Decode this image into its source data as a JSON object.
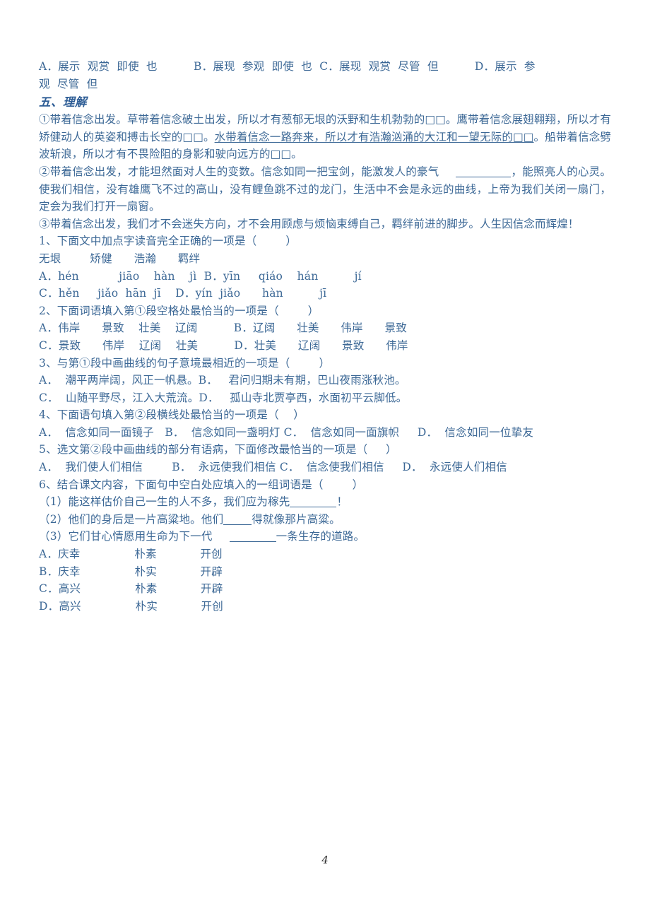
{
  "document": {
    "page_number": "4",
    "text_color": "#3c6896",
    "page_number_color": "#2b2b2b",
    "background_color": "#ffffff"
  },
  "top_options": {
    "line1": "A．展示  观赏  即使  也          B．展现  参观  即使  也  C．展现  观赏  尽管  但          D．展示  参",
    "line2": "观  尽管  但"
  },
  "section": {
    "heading": "五、理解"
  },
  "passage": {
    "para1_pre": "①带着信念出发。草带着信念破土出发，所以才有葱郁无垠的沃野和生机勃勃的□□。鹰带着信念展翅翱翔，所以才有矫健动人的英姿和搏击长空的□□。",
    "para1_underlined": "水带着信念一路奔来，所以才有浩瀚汹涌的大江和一望无际的□□",
    "para1_post": "。船带着信念劈波斩浪，所以才有不畏险阻的身影和驶向远方的□□。",
    "para2_pre": "②带着信念出发，才能坦然面对人生的变数。信念如同一把宝剑，能激发人的豪气",
    "para2_mid": "，能照亮人的心灵。",
    "para2_rest": "使我们相信，没有雄鹰飞不过的高山，没有鲤鱼跳不过的龙门，生活中不会是永远的曲线，上帝为我们关闭一扇门，定会为我们打开一扇窗。",
    "para3": "③带着信念出发，我们才不会迷失方向，才不会用顾虑与烦恼束缚自己，羁绊前进的脚步。人生因信念而辉煌！"
  },
  "questions": [
    {
      "stem": "1、下面文中加点字读音完全正确的一项是（        ）",
      "words_line": "无垠        矫健      浩瀚      羁绊",
      "options": [
        "A．hén           jiāo    hàn    jì  B．yīn     qiáo    hán          jí",
        "C．hěn     jiǎo  hān  jī    D．yín  jiǎo      hàn          jī"
      ]
    },
    {
      "stem": "2、下面词语填入第①段空格处最恰当的一项是（        ）",
      "options": [
        "A．伟岸      景致    壮美    辽阔          B．辽阔      壮美      伟岸      景致",
        "C．景致      伟岸    辽阔    壮美          D．壮美      辽阔      景致      伟岸"
      ]
    },
    {
      "stem": "3、与第①段中画曲线的句子意境最相近的一项是（        ）",
      "options": [
        "A．  潮平两岸阔，风正一帆悬。B．   君问归期未有期，巴山夜雨涨秋池。",
        "C．  山随平野尽，江入大荒流。D．   孤山寺北贾亭西，水面初平云脚低。"
      ]
    },
    {
      "stem": "4、下面语句填入第②段横线处最恰当的一项是（    ）",
      "options": [
        "A．  信念如同一面镜子   B．  信念如同一盏明灯 C．  信念如同一面旗帜     D．  信念如同一位挚友"
      ]
    },
    {
      "stem": "5、选文第②段中画曲线的部分有语病，下面修改最恰当的一项是（     ）",
      "options": [
        "A．  我们使人们相信        B．  永远使我们相信 C．  信念使我们相信     D．  永远使人们相信"
      ]
    },
    {
      "stem": "6、结合课文内容，下面句中空白处应填入的一组词语是（        ）",
      "subitems": [
        {
          "pre": "（1）能这样估价自己一生的人不多，我们应为稼先",
          "post": "！"
        },
        {
          "pre": "（2）他们的身后是一片高粱地。他们",
          "post": "得就像那片高粱。"
        },
        {
          "pre": "（3）它们甘心情愿用生命为下一代",
          "post": "一条生存的道路。"
        }
      ],
      "final_options": [
        "A．庆幸               朴素            开创",
        "B．庆幸               朴实            开辟",
        "C．高兴               朴素            开辟",
        "D．高兴               朴实            开创"
      ]
    }
  ]
}
